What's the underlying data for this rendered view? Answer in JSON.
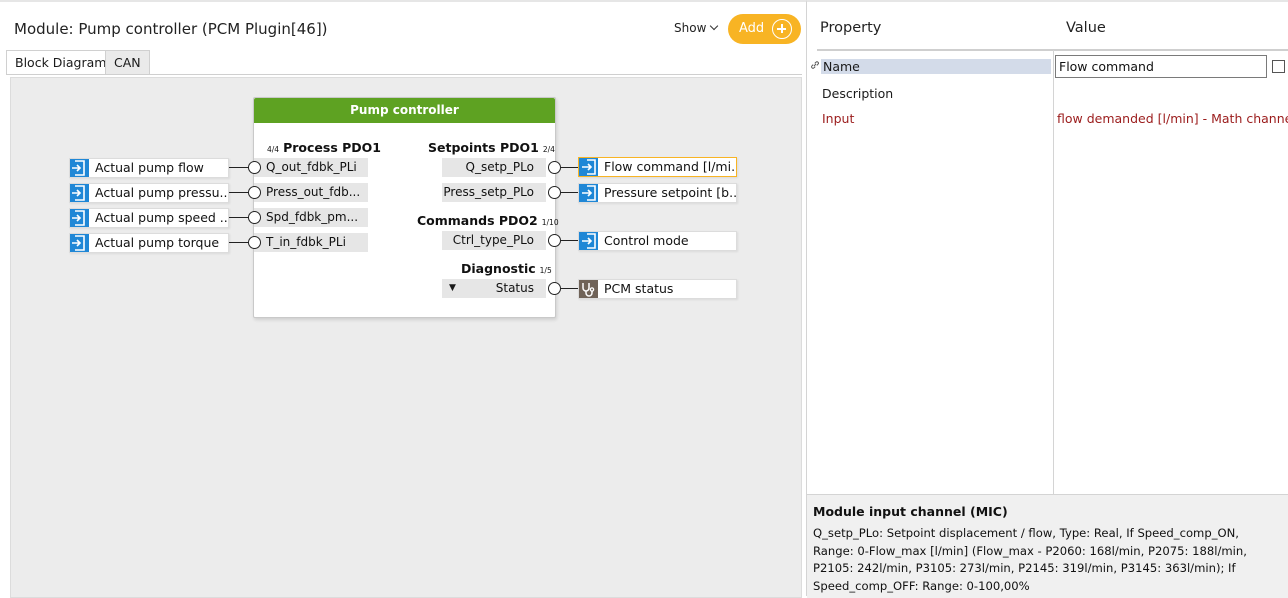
{
  "module": {
    "title": "Module: Pump controller (PCM Plugin[46])"
  },
  "toolbar": {
    "show_label": "Show",
    "add_label": "Add"
  },
  "tabs": [
    {
      "label": "Block Diagram"
    },
    {
      "label": "CAN"
    }
  ],
  "block": {
    "title": "Pump controller",
    "sections": {
      "process": {
        "label": "Process PDO1",
        "count": "4/4"
      },
      "setpoints": {
        "label": "Setpoints PDO1",
        "count": "2/4"
      },
      "commands": {
        "label": "Commands PDO2",
        "count": "1/10"
      },
      "diagnostic": {
        "label": "Diagnostic",
        "count": "1/5"
      }
    },
    "inputs": [
      "Q_out_fdbk_PLi",
      "Press_out_fdb...",
      "Spd_fdbk_pm...",
      "T_in_fdbk_PLi"
    ],
    "setpoint_outputs": [
      "Q_setp_PLo",
      "Press_setp_PLo"
    ],
    "command_outputs": [
      "Ctrl_type_PLo"
    ],
    "diagnostic_outputs": [
      "Status"
    ],
    "status_dropdown": "▼"
  },
  "input_channels": [
    "Actual pump flow",
    "Actual pump pressu...",
    "Actual pump speed ...",
    "Actual pump torque"
  ],
  "output_channels": [
    "Flow command [l/mi...",
    "Pressure setpoint [b...",
    "Control mode",
    "PCM status"
  ],
  "properties": {
    "header_property": "Property",
    "header_value": "Value",
    "rows": {
      "name": {
        "label": "Name",
        "value": "Flow command"
      },
      "description": {
        "label": "Description",
        "value": ""
      },
      "input": {
        "label": "Input",
        "value": "flow demanded [l/min] - Math channel ("
      }
    }
  },
  "info": {
    "title": "Module input channel (MIC)",
    "body": "Q_setp_PLo: Setpoint displacement / flow, Type: Real, If Speed_comp_ON, Range: 0-Flow_max [l/min] (Flow_max - P2060: 168l/min, P2075: 188l/min, P2105: 242l/min, P3105: 273l/min, P2145: 319l/min, P3145: 363l/min); If Speed_comp_OFF: Range: 0-100,00%"
  },
  "colors": {
    "block_header": "#5ea222",
    "add_button": "#f8b424",
    "channel_icon": "#1f87d6",
    "selected_border": "#f8b424",
    "input_label": "#9b1c1c",
    "selection_bg": "#d3dbe9"
  },
  "icons": {
    "input_channel": "enter-arrow-icon",
    "output_channel": "exit-arrow-icon",
    "status_channel": "stethoscope-icon",
    "add": "plus-circle-icon",
    "show": "chevron-down-icon",
    "link": "link-icon"
  }
}
